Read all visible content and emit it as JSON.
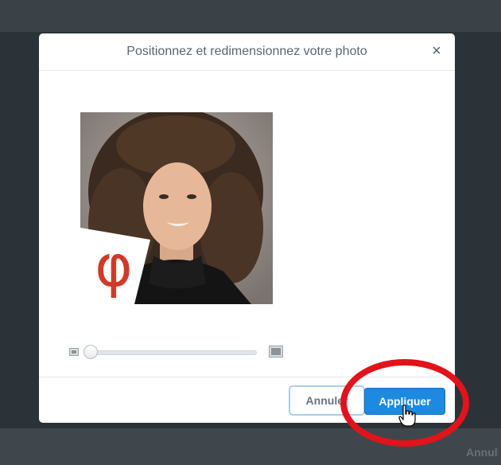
{
  "dialog": {
    "title": "Positionnez et redimensionnez votre photo",
    "close_label": "×",
    "cancel_label": "Annuler",
    "apply_label": "Appliquer"
  },
  "background": {
    "bottom_right_text": "Annul"
  },
  "zoom": {
    "level": 0.0,
    "min_icon": "image-small-icon",
    "max_icon": "image-large-icon"
  },
  "photo": {
    "badge_glyph": "φ"
  },
  "colors": {
    "primary": "#1d8ae0",
    "highlight_circle": "#e2131a",
    "badge_glyph": "#d03a2a"
  }
}
